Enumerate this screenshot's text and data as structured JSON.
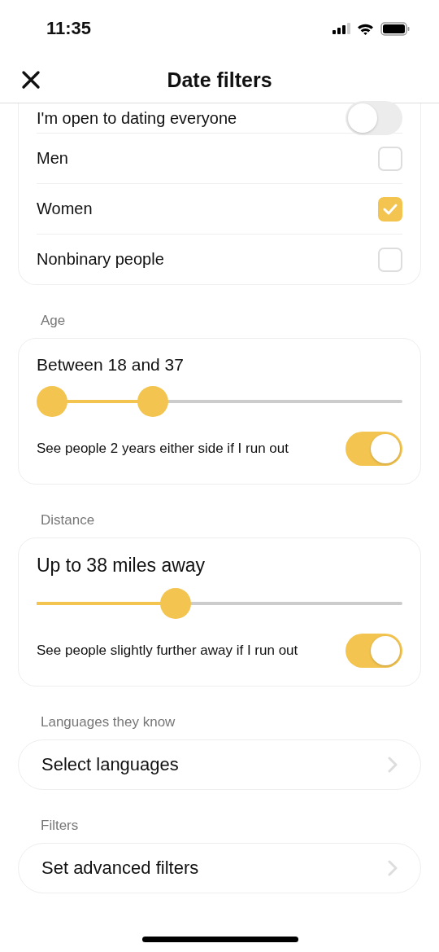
{
  "status_bar": {
    "time": "11:35"
  },
  "header": {
    "title": "Date filters"
  },
  "interest": {
    "toggle": {
      "label": "I'm open to dating everyone",
      "on": false
    },
    "options": [
      {
        "label": "Men",
        "checked": false
      },
      {
        "label": "Women",
        "checked": true
      },
      {
        "label": "Nonbinary people",
        "checked": false
      }
    ]
  },
  "age": {
    "heading": "Age",
    "value": "Between 18 and 37",
    "thumbs": [
      {
        "level": 0
      },
      {
        "level": 0.3
      }
    ],
    "extend": {
      "label": "See people 2 years either side if I run out",
      "on": true
    }
  },
  "distance": {
    "heading": "Distance",
    "value": "Up to 38 miles away",
    "level": 0.37,
    "extend": {
      "label": "See people slightly further away if I run out",
      "on": true
    }
  },
  "links": [
    {
      "heading": "Languages they know",
      "label": "Select languages"
    },
    {
      "heading": "Filters",
      "label": "Set advanced filters"
    }
  ]
}
